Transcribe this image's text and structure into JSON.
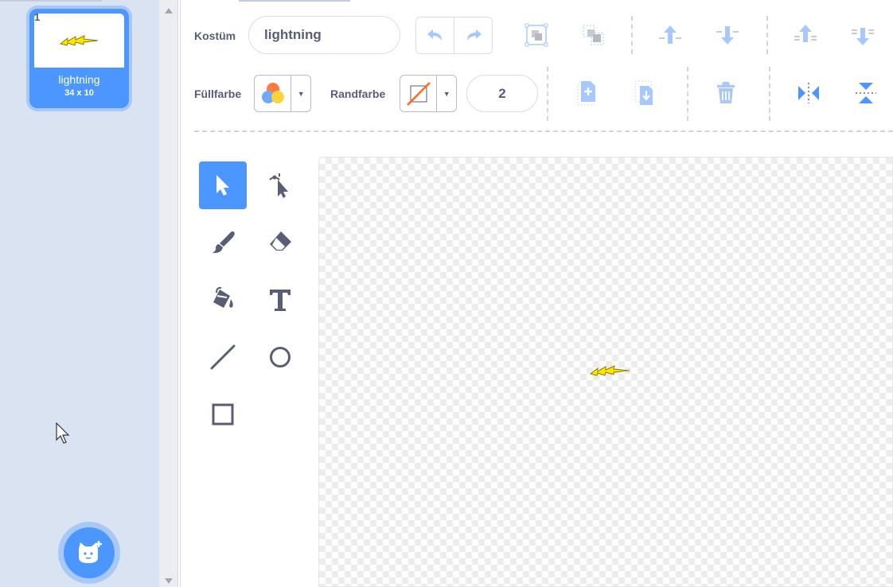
{
  "costumes": [
    {
      "number": "1",
      "name": "lightning",
      "size": "34 x 10"
    }
  ],
  "toolbar": {
    "costume_label": "Kostüm",
    "costume_name": "lightning",
    "fill_label": "Füllfarbe",
    "outline_label": "Randfarbe",
    "outline_width": "2"
  },
  "colors": {
    "accent": "#4c97ff",
    "panel_bg": "#d9e3f2",
    "text": "#575e75",
    "outline_none": "#ff6a1a",
    "sprite": "#ffe500"
  },
  "icons": {
    "toolbar": [
      "undo-icon",
      "redo-icon",
      "group-icon",
      "ungroup-icon",
      "forward-icon",
      "backward-icon",
      "front-icon",
      "back-icon",
      "copy-icon",
      "paste-icon",
      "delete-icon",
      "flip-horizontal-icon",
      "flip-vertical-icon"
    ],
    "tools": [
      "select-icon",
      "reshape-icon",
      "brush-icon",
      "eraser-icon",
      "fill-icon",
      "text-icon",
      "line-icon",
      "circle-icon",
      "rectangle-icon"
    ]
  }
}
